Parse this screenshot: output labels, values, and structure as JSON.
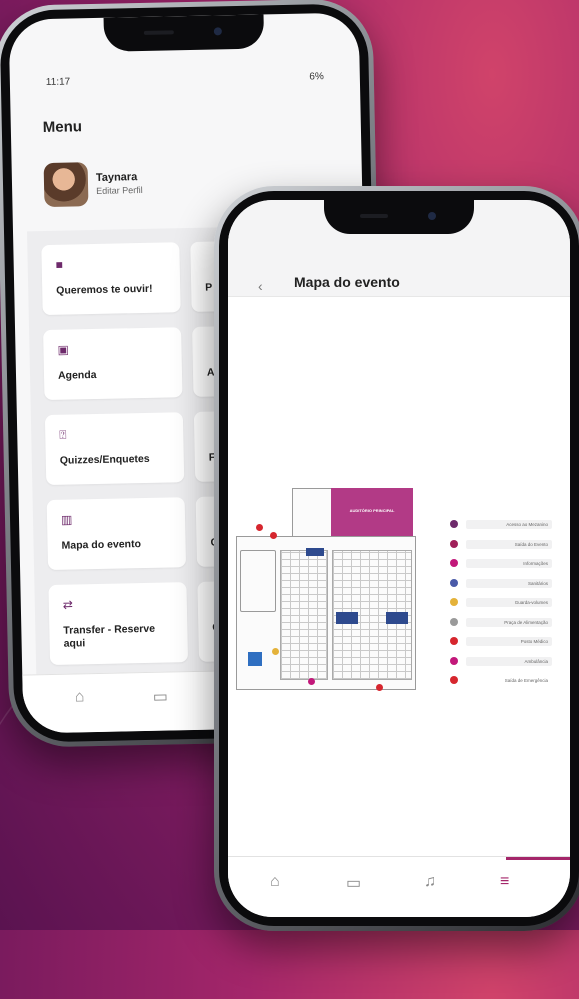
{
  "phone1": {
    "status": {
      "time": "11:17",
      "right": "6%"
    },
    "menu_title": "Menu",
    "profile": {
      "name": "Taynara",
      "edit": "Editar Perfil"
    },
    "cards": [
      {
        "label": "Queremos te ouvir!",
        "icon": "chat-bubble-icon"
      },
      {
        "label": "Agenda",
        "icon": "calendar-icon"
      },
      {
        "label": "Quizzes/Enquetes",
        "icon": "quiz-icon"
      },
      {
        "label": "Mapa do evento",
        "icon": "map-icon"
      },
      {
        "label": "Transfer - Reserve aqui",
        "icon": "transfer-icon"
      }
    ],
    "peek_letters": [
      "P",
      "A",
      "F",
      "C",
      "C"
    ],
    "tabs": [
      {
        "icon": "home-icon",
        "glyph": "⌂"
      },
      {
        "icon": "chat-icon",
        "glyph": "▭"
      }
    ]
  },
  "phone2": {
    "back_glyph": "‹",
    "title": "Mapa do evento",
    "map": {
      "main_hall_label": "AUDITÓRIO PRINCIPAL",
      "legend": [
        {
          "label": "Acesso ao Mezanino",
          "color": "#6e2a6b"
        },
        {
          "label": "Saída do Evento",
          "color": "#a0205a"
        },
        {
          "label": "Informações",
          "color": "#c2187a"
        },
        {
          "label": "Sanitários",
          "color": "#4a5aa8"
        },
        {
          "label": "Guarda-volumes",
          "color": "#e4b23a"
        },
        {
          "label": "Praça de Alimentação",
          "color": "#9a9a9a"
        },
        {
          "label": "Posto Médico",
          "color": "#d6262e"
        },
        {
          "label": "Ambulância",
          "color": "#c2187a"
        },
        {
          "label": "Saída de Emergência",
          "color": "#d6262e"
        }
      ]
    },
    "tabs": [
      {
        "icon": "home-icon",
        "glyph": "⌂"
      },
      {
        "icon": "chat-icon",
        "glyph": "▭"
      },
      {
        "icon": "bell-icon",
        "glyph": "♫"
      },
      {
        "icon": "menu-icon",
        "glyph": "≡"
      }
    ]
  }
}
